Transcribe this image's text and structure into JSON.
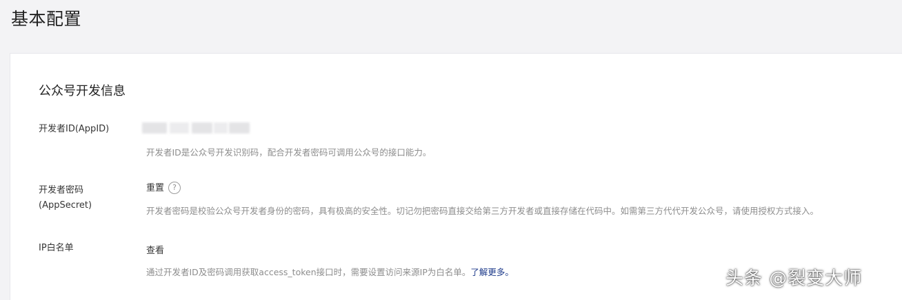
{
  "page": {
    "title": "基本配置"
  },
  "section": {
    "title": "公众号开发信息"
  },
  "rows": {
    "appid": {
      "label": "开发者ID(AppID)",
      "description": "开发者ID是公众号开发识别码，配合开发者密码可调用公众号的接口能力。"
    },
    "appsecret": {
      "label_line1": "开发者密码",
      "label_line2": "(AppSecret)",
      "action_label": "重置",
      "help_glyph": "?",
      "description": "开发者密码是校验公众号开发者身份的密码，具有极高的安全性。切记勿把密码直接交给第三方开发者或直接存储在代码中。如需第三方代代开发公众号，请使用授权方式接入。"
    },
    "ip_whitelist": {
      "label": "IP白名单",
      "action_label": "查看",
      "description_prefix": "通过开发者ID及密码调用获取access_token接口时，需要设置访问来源IP为白名单。",
      "learn_more": "了解更多。"
    }
  },
  "watermark": {
    "text": "头条 @裂变大师"
  },
  "icons": {
    "help": "question-circle-icon"
  },
  "colors": {
    "background": "#f3f3f5",
    "panel": "#ffffff",
    "link": "#1d3a8a",
    "muted_text": "#8d8d8d"
  }
}
